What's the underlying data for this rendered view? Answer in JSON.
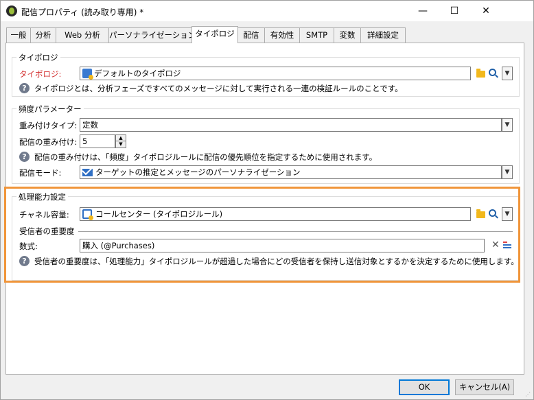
{
  "window": {
    "title": "配信プロパティ (読み取り専用) *",
    "controls": {
      "minimize": "—",
      "maximize": "☐",
      "close": "✕"
    }
  },
  "tabs": [
    {
      "label": "一般"
    },
    {
      "label": "分析"
    },
    {
      "label": "Web 分析"
    },
    {
      "label": "パーソナライゼーション"
    },
    {
      "label": "タイポロジ",
      "active": true
    },
    {
      "label": "配信"
    },
    {
      "label": "有効性"
    },
    {
      "label": "SMTP"
    },
    {
      "label": "変数"
    },
    {
      "label": "詳細設定"
    }
  ],
  "typology": {
    "group_title": "タイポロジ",
    "label": "タイポロジ:",
    "value": "デフォルトのタイポロジ",
    "help": "タイポロジとは、分析フェーズですべてのメッセージに対して実行される一連の検証ルールのことです。"
  },
  "frequency": {
    "group_title": "頻度パラメーター",
    "weight_type_label": "重み付けタイプ:",
    "weight_type_value": "定数",
    "weight_label": "配信の重み付け:",
    "weight_value": "5",
    "help": "配信の重み付けは、「頻度」タイポロジルールに配信の優先順位を指定するために使用されます。",
    "mode_label": "配信モード:",
    "mode_value": "ターゲットの推定とメッセージのパーソナライゼーション"
  },
  "capacity": {
    "group_title": "処理能力設定",
    "channel_label": "チャネル容量:",
    "channel_value": "コールセンター (タイポロジルール)",
    "importance_title": "受信者の重要度",
    "formula_label": "数式:",
    "formula_value": "購入 (@Purchases)",
    "help": "受信者の重要度は、「処理能力」タイポロジルールが超過した場合にどの受信者を保持し送信対象とするかを決定するために使用します。"
  },
  "buttons": {
    "ok": "OK",
    "cancel": "キャンセル(A)"
  },
  "colors": {
    "required_label": "#d32f2f",
    "highlight_border": "#f0953a",
    "default_button_border": "#0078d7"
  }
}
